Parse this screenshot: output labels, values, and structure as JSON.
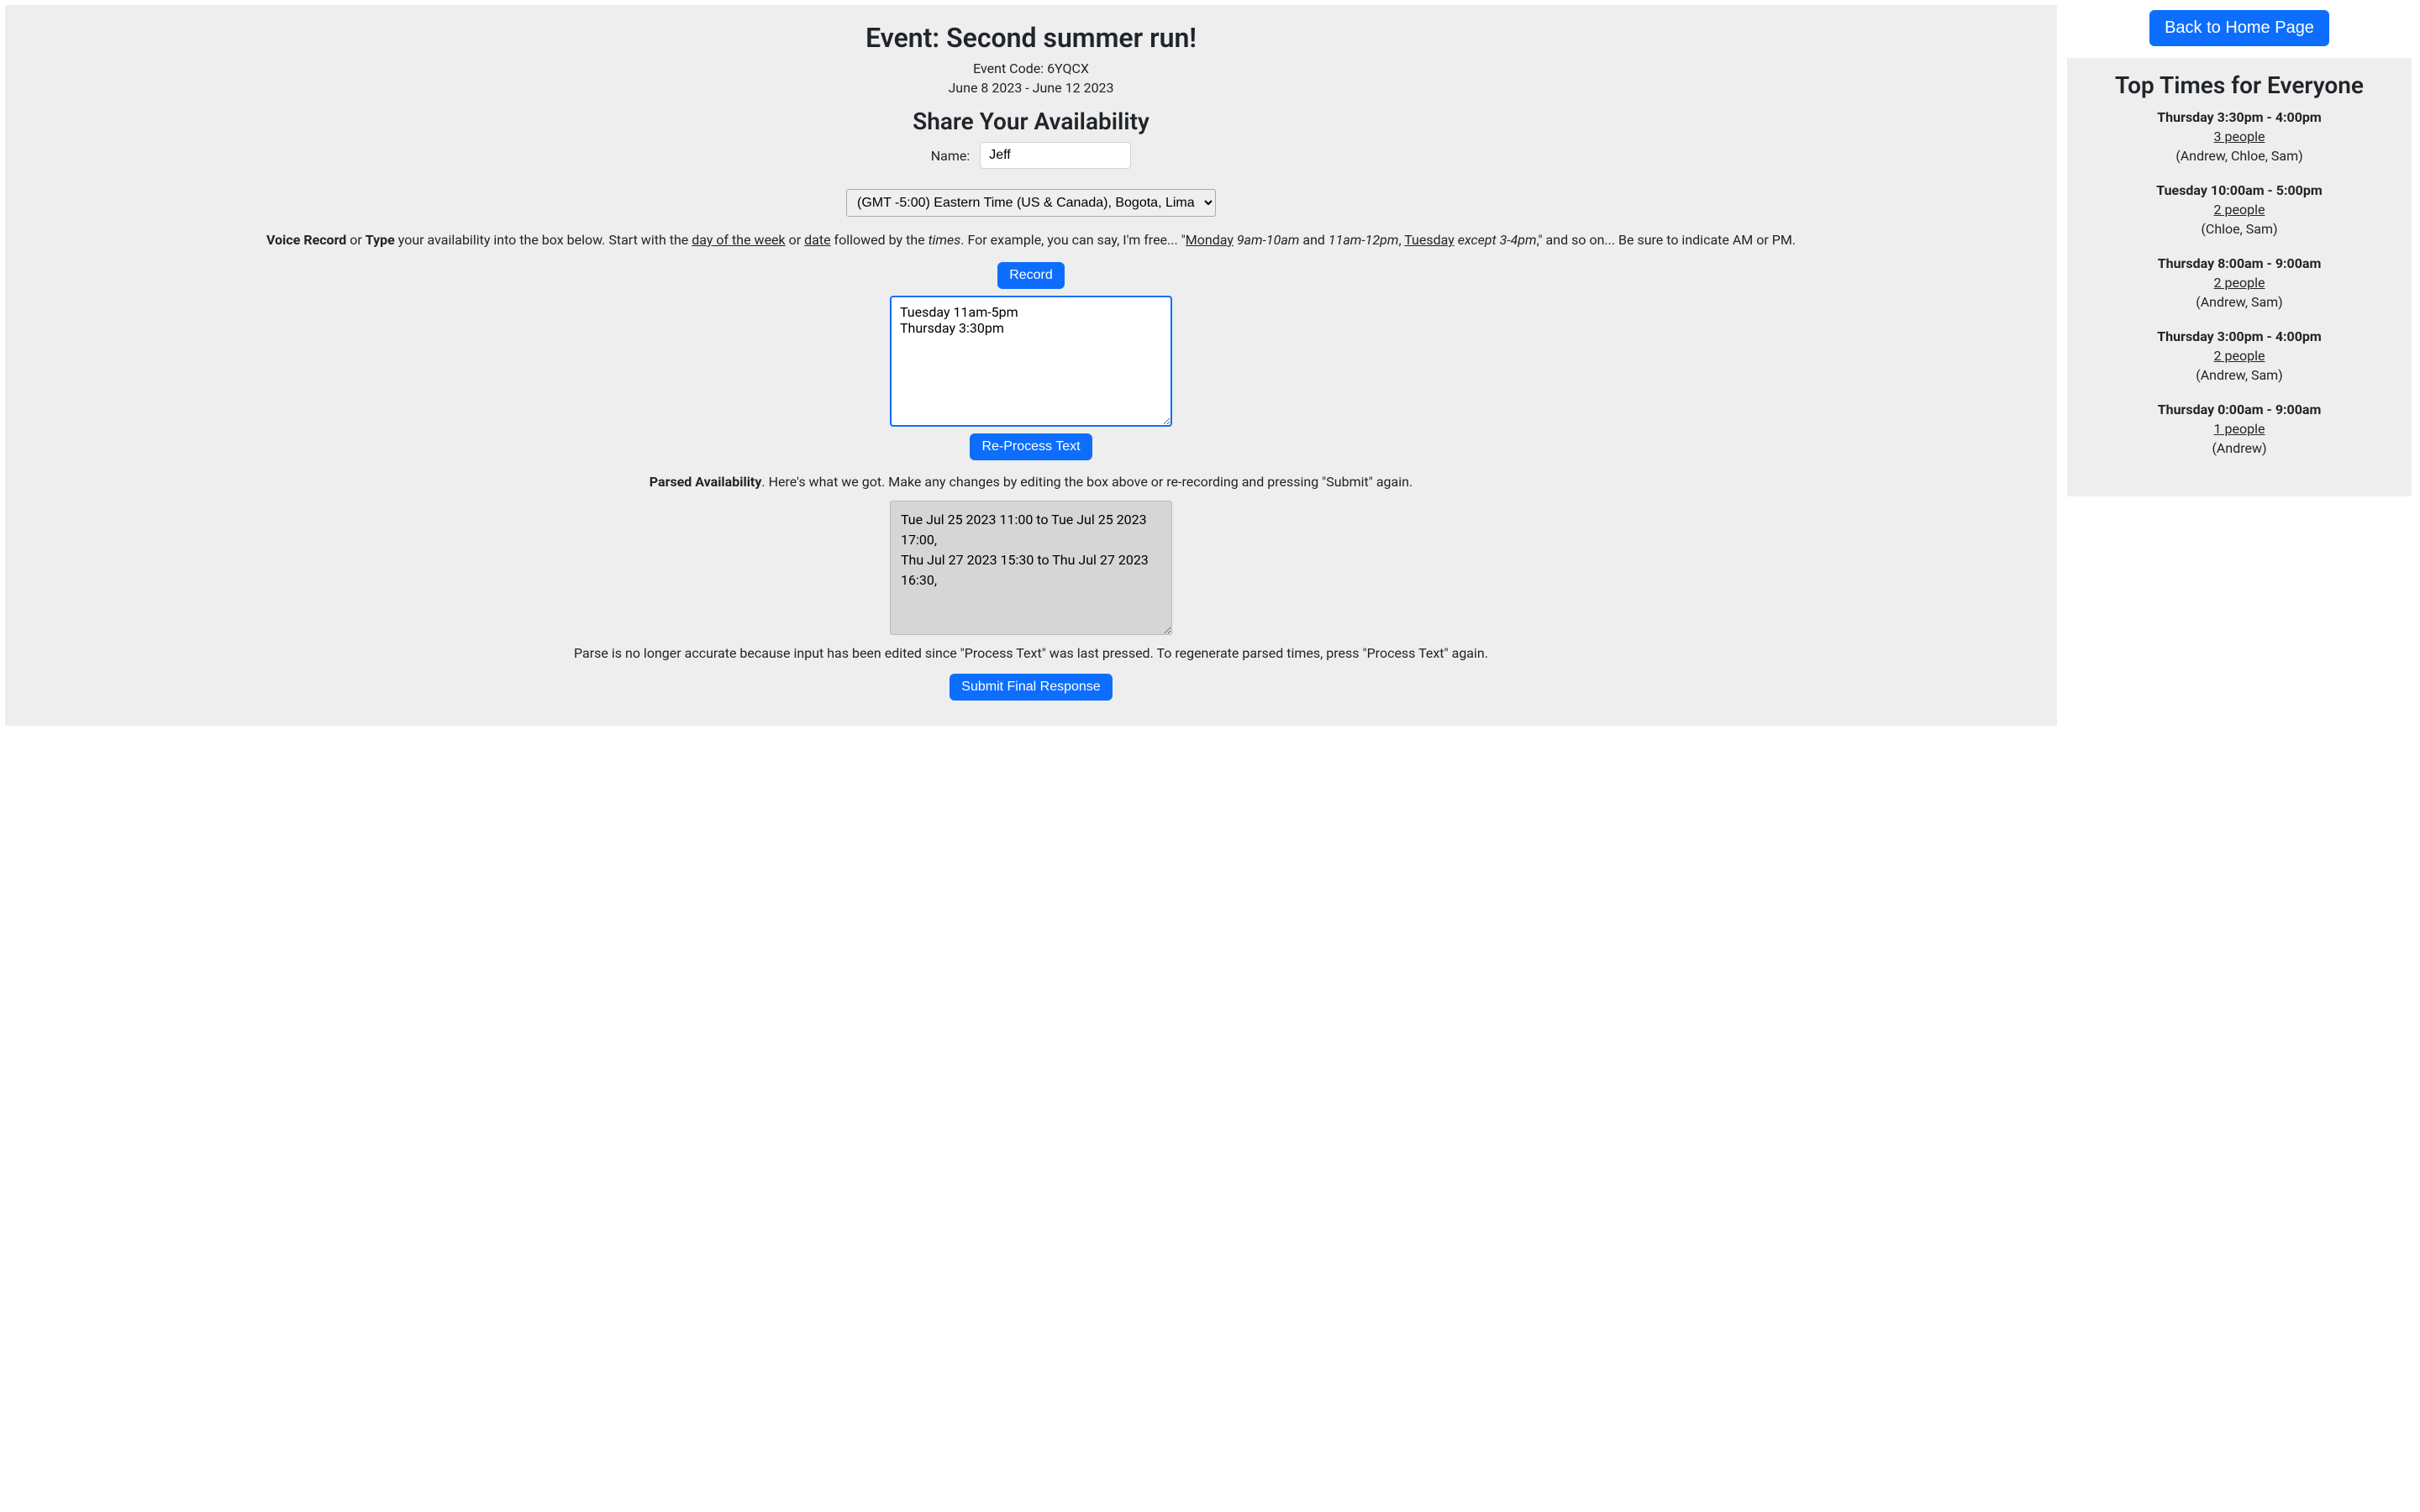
{
  "event": {
    "title": "Event: Second summer run!",
    "code_line": "Event Code: 6YQCX",
    "dates": "June 8 2023 - June 12 2023"
  },
  "share": {
    "heading": "Share Your Availability",
    "name_label": "Name:",
    "name_value": "Jeff",
    "timezone_selected": "(GMT -5:00) Eastern Time (US & Canada), Bogota, Lima",
    "record_button": "Record",
    "reprocess_button": "Re-Process Text",
    "submit_button": "Submit Final Response",
    "availability_text": "Tuesday 11am-5pm\nThursday 3:30pm",
    "parsed_text": "Tue Jul 25 2023 11:00 to Tue Jul 25 2023 17:00,\nThu Jul 27 2023 15:30 to Thu Jul 27 2023 16:30,",
    "stale_warning": "Parse is no longer accurate because input has been edited since \"Process Text\" was last pressed. To regenerate parsed times, press \"Process Text\" again."
  },
  "instructions": {
    "voice_record": "Voice Record",
    "or": " or ",
    "type": "Type",
    "rest1": " your availability into the box below. Start with the ",
    "dow": "day of the week",
    "or2": " or ",
    "date": "date",
    "rest2": " followed by the ",
    "times_word": "times",
    "rest3": ". For example, you can say, I'm free... \"",
    "monday": "Monday",
    "ex1": " 9am-10am",
    "and": " and ",
    "ex2": "11am-12pm",
    "comma": ", ",
    "tuesday": "Tuesday",
    "ex3": " except 3-4pm",
    "rest4": ",\" and so on... Be sure to indicate AM or PM."
  },
  "parsed_label": {
    "strong": "Parsed Availability",
    "rest": ". Here's what we got. Make any changes by editing the box above or re-recording and pressing \"Submit\" again."
  },
  "right": {
    "home_button": "Back to Home Page",
    "panel_title": "Top Times for Everyone",
    "slots": [
      {
        "time": "Thursday 3:30pm - 4:00pm",
        "count": "3 people",
        "people": "(Andrew, Chloe, Sam)"
      },
      {
        "time": "Tuesday 10:00am - 5:00pm",
        "count": "2 people",
        "people": "(Chloe, Sam)"
      },
      {
        "time": "Thursday 8:00am - 9:00am",
        "count": "2 people",
        "people": "(Andrew, Sam)"
      },
      {
        "time": "Thursday 3:00pm - 4:00pm",
        "count": "2 people",
        "people": "(Andrew, Sam)"
      },
      {
        "time": "Thursday 0:00am - 9:00am",
        "count": "1 people",
        "people": "(Andrew)"
      }
    ]
  }
}
